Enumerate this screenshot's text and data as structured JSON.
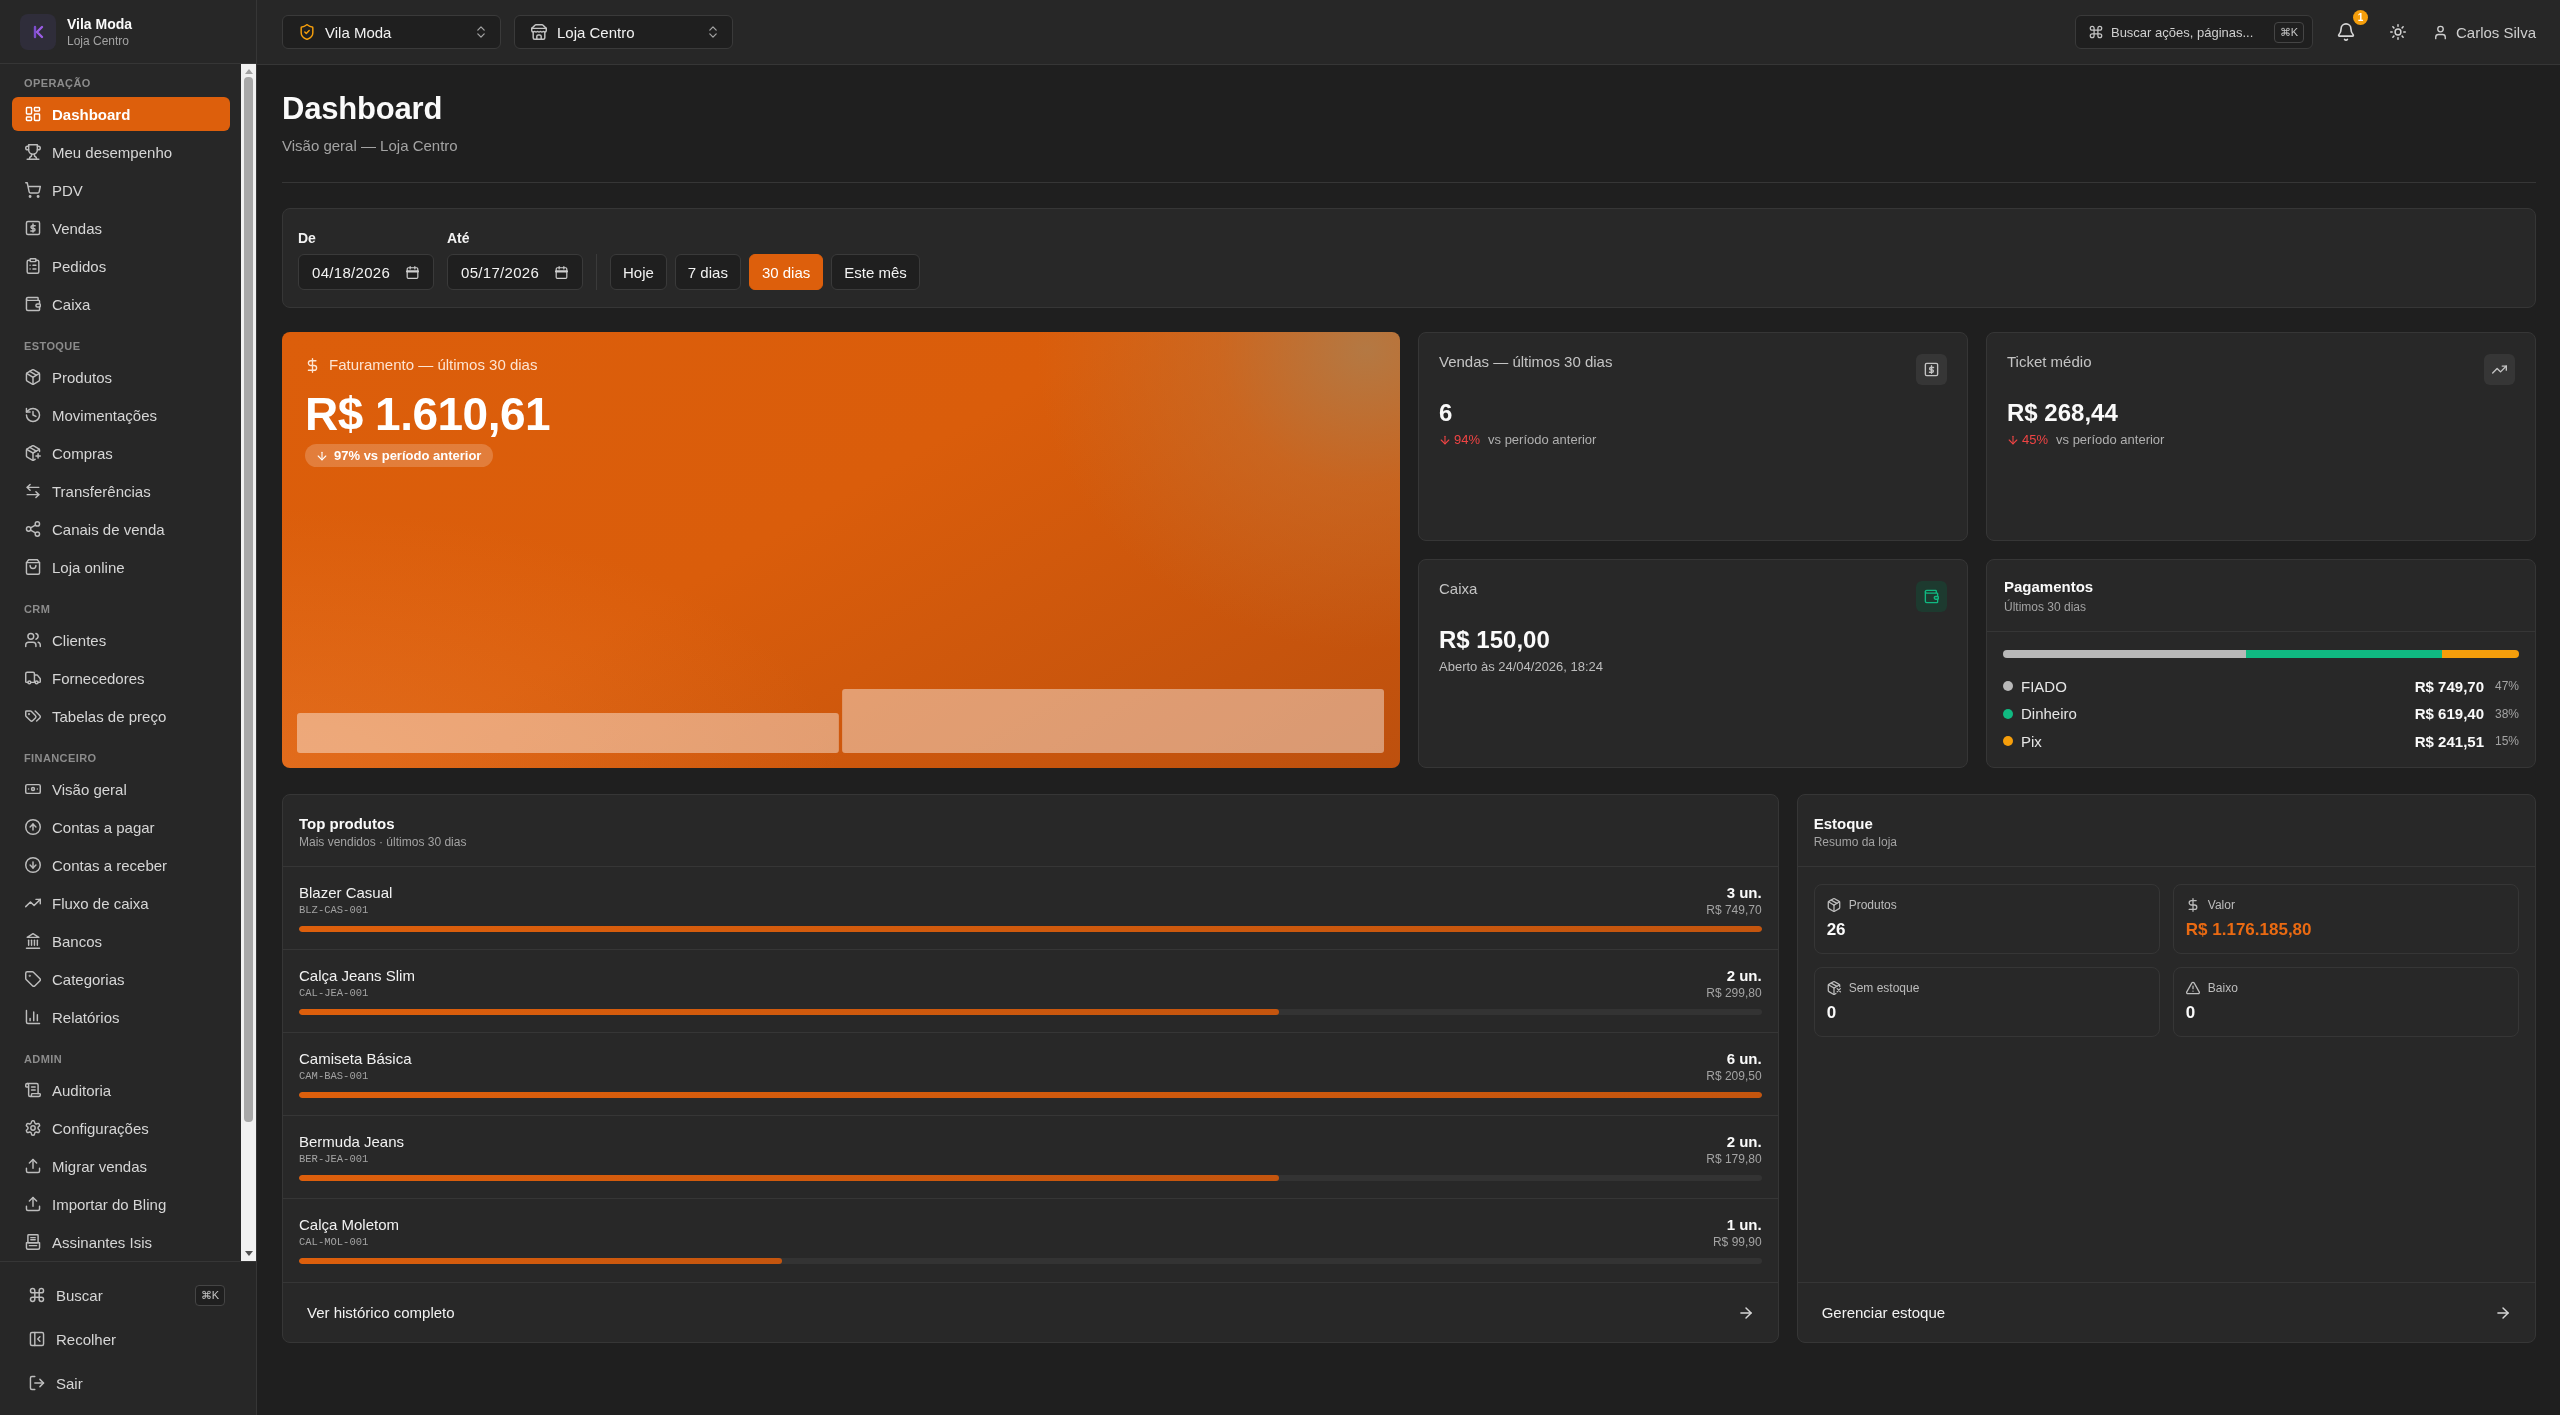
{
  "sidebar": {
    "brand": {
      "name": "Vila Moda",
      "store": "Loja Centro"
    },
    "sections": [
      {
        "title": "OPERAÇÃO",
        "items": [
          {
            "label": "Dashboard",
            "selected": true
          },
          {
            "label": "Meu desempenho",
            "selected": false
          },
          {
            "label": "PDV",
            "selected": false
          },
          {
            "label": "Vendas",
            "selected": false
          },
          {
            "label": "Pedidos",
            "selected": false
          },
          {
            "label": "Caixa",
            "selected": false
          }
        ]
      },
      {
        "title": "ESTOQUE",
        "items": [
          {
            "label": "Produtos",
            "selected": false
          },
          {
            "label": "Movimentações",
            "selected": false
          },
          {
            "label": "Compras",
            "selected": false
          },
          {
            "label": "Transferências",
            "selected": false
          },
          {
            "label": "Canais de venda",
            "selected": false
          },
          {
            "label": "Loja online",
            "selected": false
          }
        ]
      },
      {
        "title": "CRM",
        "items": [
          {
            "label": "Clientes",
            "selected": false
          },
          {
            "label": "Fornecedores",
            "selected": false
          },
          {
            "label": "Tabelas de preço",
            "selected": false
          }
        ]
      },
      {
        "title": "FINANCEIRO",
        "items": [
          {
            "label": "Visão geral",
            "selected": false
          },
          {
            "label": "Contas a pagar",
            "selected": false
          },
          {
            "label": "Contas a receber",
            "selected": false
          },
          {
            "label": "Fluxo de caixa",
            "selected": false
          },
          {
            "label": "Bancos",
            "selected": false
          },
          {
            "label": "Categorias",
            "selected": false
          },
          {
            "label": "Relatórios",
            "selected": false
          }
        ]
      },
      {
        "title": "ADMIN",
        "items": [
          {
            "label": "Auditoria",
            "selected": false
          },
          {
            "label": "Configurações",
            "selected": false
          },
          {
            "label": "Migrar vendas",
            "selected": false
          },
          {
            "label": "Importar do Bling",
            "selected": false
          },
          {
            "label": "Assinantes Isis",
            "selected": false
          }
        ]
      }
    ],
    "footer": [
      {
        "label": "Buscar",
        "shortcut": "⌘K"
      },
      {
        "label": "Recolher"
      },
      {
        "label": "Sair"
      }
    ]
  },
  "topbar": {
    "organization": {
      "label": "Vila Moda"
    },
    "store": {
      "label": "Loja Centro"
    },
    "search": {
      "label": "Buscar ações, páginas...",
      "shortcut": "⌘K"
    },
    "notifications": {
      "count": "1"
    },
    "user": {
      "name": "Carlos Silva"
    }
  },
  "page": {
    "title": "Dashboard",
    "subtitle": "Visão geral — Loja Centro"
  },
  "filters": {
    "from": {
      "label": "De",
      "value": "04/18/2026"
    },
    "to": {
      "label": "Até",
      "value": "05/17/2026"
    },
    "presets": [
      {
        "label": "Hoje",
        "selected": false
      },
      {
        "label": "7 dias",
        "selected": false
      },
      {
        "label": "30 dias",
        "selected": true
      },
      {
        "label": "Este mês",
        "selected": false
      }
    ]
  },
  "revenue": {
    "label": "Faturamento — últimos 30 dias",
    "value": "R$ 1.610,61",
    "change": {
      "declined": true,
      "text": "97% vs período anterior"
    }
  },
  "stat_cards": [
    {
      "label": "Vendas — últimos 30 dias",
      "value": "6",
      "highlighted": false,
      "change": {
        "declined": true,
        "value": "94%",
        "text": "vs período anterior"
      }
    },
    {
      "label": "Ticket médio",
      "value": "R$ 268,44",
      "highlighted": false,
      "change": {
        "declined": true,
        "value": "45%",
        "text": "vs período anterior"
      }
    },
    {
      "label": "Caixa",
      "value": "R$ 150,00",
      "highlighted": true,
      "note": "Aberto às 24/04/2026, 18:24"
    }
  ],
  "payments": {
    "title": "Pagamentos",
    "subtitle": "Últimos 30 dias",
    "items": [
      {
        "label": "FIADO",
        "amount": "R$ 749,70",
        "share": "47%",
        "color": "#b8b8b8"
      },
      {
        "label": "Dinheiro",
        "amount": "R$ 619,40",
        "share": "38%",
        "color": "#10b981"
      },
      {
        "label": "Pix",
        "amount": "R$ 241,51",
        "share": "15%",
        "color": "#f59e0b"
      }
    ]
  },
  "top_products": {
    "title": "Top produtos",
    "subtitle": "Mais vendidos · últimos 30 dias",
    "items": [
      {
        "name": "Blazer Casual",
        "sku": "BLZ-CAS-001",
        "quantity": "3 un.",
        "amount": "R$ 749,70",
        "level": 1
      },
      {
        "name": "Calça Jeans Slim",
        "sku": "CAL-JEA-001",
        "quantity": "2 un.",
        "amount": "R$ 299,80",
        "level": 0.67
      },
      {
        "name": "Camiseta Básica",
        "sku": "CAM-BAS-001",
        "quantity": "6 un.",
        "amount": "R$ 209,50",
        "level": 1
      },
      {
        "name": "Bermuda Jeans",
        "sku": "BER-JEA-001",
        "quantity": "2 un.",
        "amount": "R$ 179,80",
        "level": 0.67
      },
      {
        "name": "Calça Moletom",
        "sku": "CAL-MOL-001",
        "quantity": "1 un.",
        "amount": "R$ 99,90",
        "level": 0.33
      }
    ],
    "footer_link": "Ver histórico completo"
  },
  "stock": {
    "title": "Estoque",
    "subtitle": "Resumo da loja",
    "stats": [
      {
        "label": "Produtos",
        "value": "26",
        "accent": false
      },
      {
        "label": "Valor",
        "value": "R$ 1.176.185,80",
        "accent": true
      },
      {
        "label": "Sem estoque",
        "value": "0",
        "accent": false
      },
      {
        "label": "Baixo",
        "value": "0",
        "accent": false
      }
    ],
    "footer_link": "Gerenciar estoque"
  }
}
